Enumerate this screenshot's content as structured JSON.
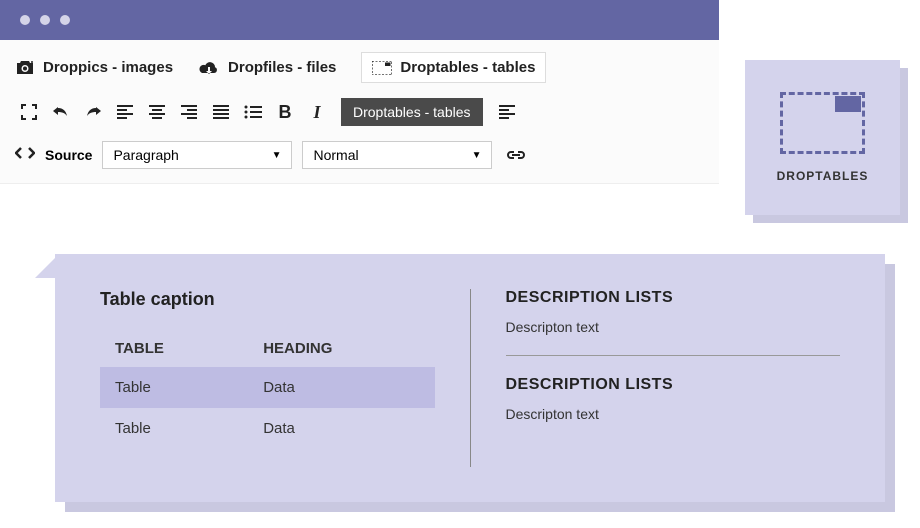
{
  "tabs": {
    "droppics": "Droppics - images",
    "dropfiles": "Dropfiles - files",
    "droptables": "Droptables - tables"
  },
  "toolbar": {
    "tooltip_label": "Droptables - tables"
  },
  "source": {
    "label": "Source",
    "style_select": "Paragraph",
    "format_select": "Normal"
  },
  "card": {
    "label": "DROPTABLES"
  },
  "table": {
    "caption": "Table caption",
    "headers": [
      "TABLE",
      "HEADING"
    ],
    "rows": [
      [
        "Table",
        "Data"
      ],
      [
        "Table",
        "Data"
      ]
    ]
  },
  "descriptions": [
    {
      "title": "DESCRIPTION LISTS",
      "text": "Descripton text"
    },
    {
      "title": "DESCRIPTION LISTS",
      "text": "Descripton text"
    }
  ]
}
